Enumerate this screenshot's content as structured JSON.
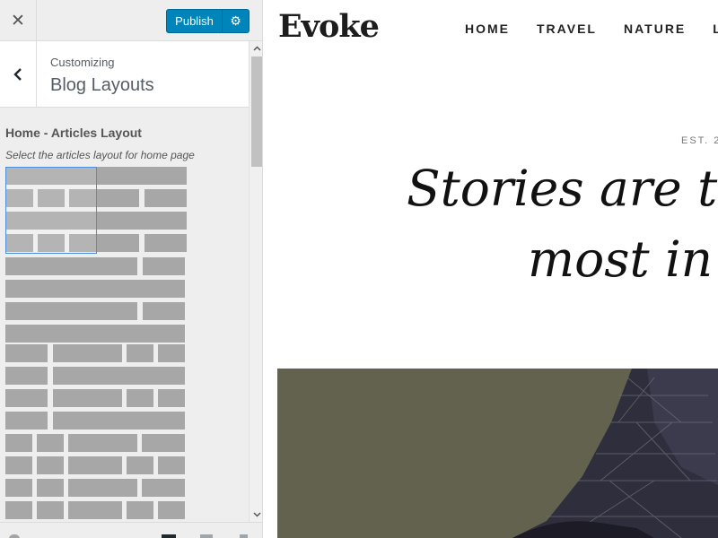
{
  "customizer": {
    "close_icon": "close-icon",
    "publish_label": "Publish",
    "settings_icon": "gear-icon",
    "back_icon": "chevron-left-icon",
    "customizing_label": "Customizing",
    "section_title": "Blog Layouts",
    "control_title": "Home - Articles Layout",
    "control_description": "Select the articles layout for home page",
    "accent_color": "#0085ba",
    "placeholder_block_color": "#a7a7a7",
    "selected_layout_index": 0
  },
  "preview": {
    "site_title": "Evoke",
    "nav": [
      "HOME",
      "TRAVEL",
      "NATURE",
      "LI"
    ],
    "est_text": "EST. 2",
    "hero_line1": "Stories are the",
    "hero_line2": "most in th",
    "hero_image_color": "#63624f"
  }
}
